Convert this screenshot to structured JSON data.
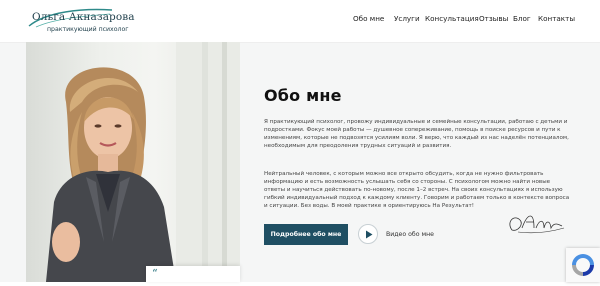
{
  "header": {
    "logo_name": "Ольга Акназарова",
    "logo_subtitle": "практикующий психолог",
    "nav": [
      {
        "label": "Обо мне"
      },
      {
        "label": "Услуги"
      },
      {
        "label": "Консультация"
      },
      {
        "label": "Отзывы"
      },
      {
        "label": "Блог"
      },
      {
        "label": "Контакты"
      }
    ]
  },
  "about": {
    "title": "Обо мне",
    "paragraph1_lines": [
      "Я практикующий психолог, провожу индивидуальные и семейные консультации, работаю с детьми и",
      "подростками. Фокус моей работы — душевное сопереживание, помощь в поиске ресурсов и пути к",
      "изменениям, которые не подвозятся усилиям воли. Я верю, что каждый из нас наделён потенциалом,",
      "необходимым для преодоления трудных ситуаций и развития."
    ],
    "paragraph2_lines": [
      "Нейтральный человек, с которым можно все открыто обсудить, когда не нужно фильтровать",
      "информацию и есть возможность услышать себя со стороны. С психологом можно найти новые",
      "ответы и научиться действовать по-новому, после 1–2 встреч. На своих консультациях я использую",
      "гибкий индивидуальный подход к каждому клиенту. Говорим и работаем только в контексте вопроса",
      "и ситуации. Без воды. В моей практике я ориентируюсь На Результат!"
    ],
    "more_button": "Подробнее обо мне",
    "video_label": "Видео обо мне"
  },
  "card": {
    "quote_mark": "“"
  },
  "colors": {
    "accent": "#1f4f63",
    "logo_text": "#24434f",
    "swoosh": "#2e8a8a",
    "section_bg": "#f5f6f6"
  },
  "icons": {
    "play": "play-icon",
    "signature": "signature-icon",
    "recaptcha": "recaptcha-icon"
  }
}
